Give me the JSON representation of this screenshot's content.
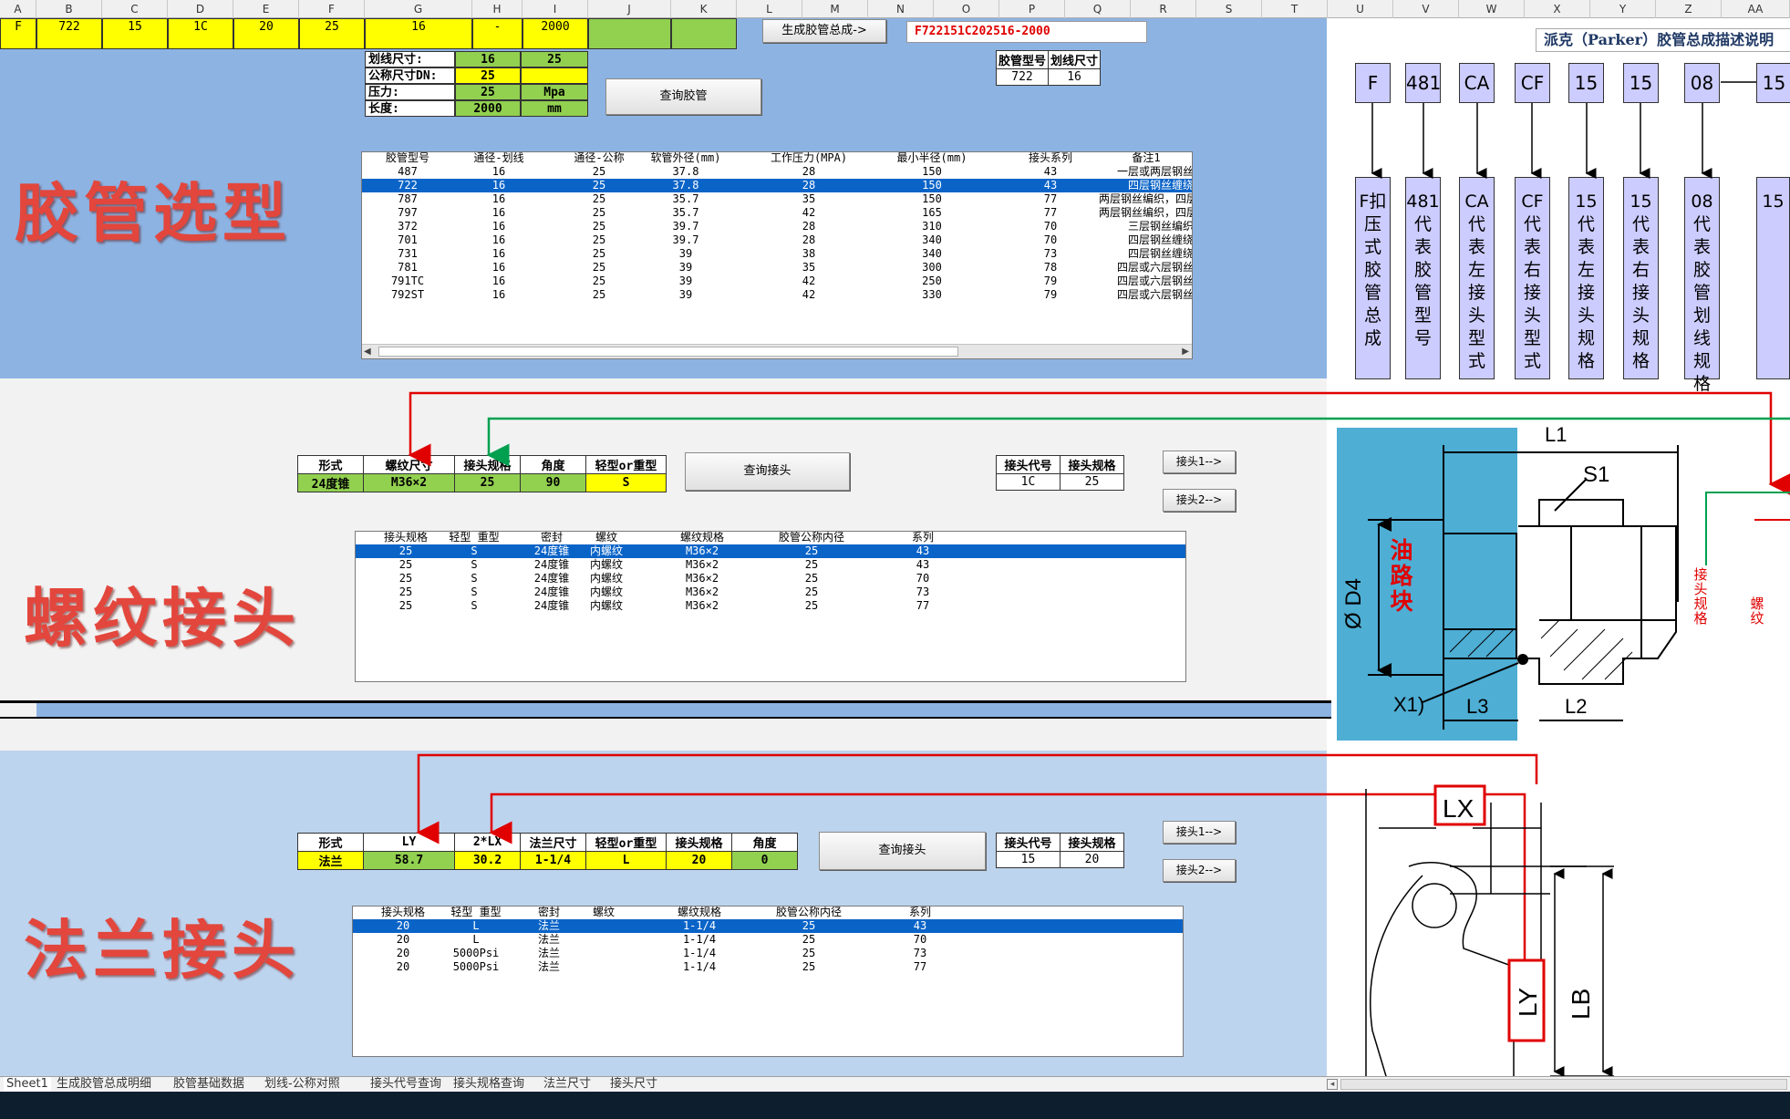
{
  "columns": [
    "A",
    "B",
    "C",
    "D",
    "E",
    "F",
    "G",
    "H",
    "I",
    "J",
    "K",
    "L",
    "M",
    "N",
    "O",
    "P",
    "Q",
    "R",
    "S",
    "T",
    "U",
    "V",
    "W",
    "X",
    "Y",
    "Z",
    "AA"
  ],
  "row1": [
    "F",
    "722",
    "15",
    "1C",
    "20",
    "25",
    "16",
    "-",
    "2000"
  ],
  "buttons": {
    "generate": "生成胶管总成->",
    "query_hose": "查询胶管",
    "query_fitting": "查询接头",
    "query_fitting2": "查询接头",
    "fitting1": "接头1-->",
    "fitting2": "接头2-->",
    "fitting1_b": "接头1-->",
    "fitting2_b": "接头2-->"
  },
  "part_code": "F722151C202516-2000",
  "hose_params": [
    {
      "label": "划线尺寸:",
      "value": "16",
      "extra": "25"
    },
    {
      "label": "公称尺寸DN:",
      "value": "25",
      "extra": ""
    },
    {
      "label": "压力:",
      "value": "25",
      "extra": "Mpa"
    },
    {
      "label": "长度:",
      "value": "2000",
      "extra": "mm"
    }
  ],
  "hose_info": {
    "headers": [
      "胶管型号",
      "划线尺寸"
    ],
    "values": [
      "722",
      "16"
    ]
  },
  "titles": {
    "hose": "胶管选型",
    "thread": "螺纹接头",
    "flange": "法兰接头"
  },
  "hose_list": {
    "headers": [
      "胶管型号",
      "通径-划线",
      "通径-公称",
      "软管外径(mm)",
      "工作压力(MPA)",
      "最小半径(mm)",
      "接头系列",
      "备注1"
    ],
    "rows": [
      [
        "487",
        "16",
        "25",
        "37.8",
        "28",
        "150",
        "43",
        "一层或两层钢丝"
      ],
      [
        "722",
        "16",
        "25",
        "37.8",
        "28",
        "150",
        "43",
        "四层钢丝缠绕"
      ],
      [
        "787",
        "16",
        "25",
        "35.7",
        "35",
        "150",
        "77",
        "两层钢丝编织，四层"
      ],
      [
        "797",
        "16",
        "25",
        "35.7",
        "42",
        "165",
        "77",
        "两层钢丝编织，四层"
      ],
      [
        "372",
        "16",
        "25",
        "39.7",
        "28",
        "310",
        "70",
        "三层钢丝编织"
      ],
      [
        "701",
        "16",
        "25",
        "39.7",
        "28",
        "340",
        "70",
        "四层钢丝缠绕"
      ],
      [
        "731",
        "16",
        "25",
        "39",
        "38",
        "340",
        "73",
        "四层钢丝缠绕"
      ],
      [
        "781",
        "16",
        "25",
        "39",
        "35",
        "300",
        "78",
        "四层或六层钢丝"
      ],
      [
        "791TC",
        "16",
        "25",
        "39",
        "42",
        "250",
        "79",
        "四层或六层钢丝"
      ],
      [
        "792ST",
        "16",
        "25",
        "39",
        "42",
        "330",
        "79",
        "四层或六层钢丝"
      ]
    ],
    "selected": 1
  },
  "thread_sel": {
    "headers": [
      "形式",
      "螺纹尺寸",
      "接头规格",
      "角度",
      "轻型or重型"
    ],
    "values": [
      "24度锥",
      "M36×2",
      "25",
      "90",
      "S"
    ]
  },
  "thread_code": {
    "headers": [
      "接头代号",
      "接头规格"
    ],
    "values": [
      "1C",
      "25"
    ]
  },
  "thread_list": {
    "headers": [
      "接头规格",
      "轻型 重型",
      "密封",
      "螺纹",
      "螺纹规格",
      "胶管公称内径",
      "系列"
    ],
    "rows": [
      [
        "25",
        "S",
        "24度锥",
        "内螺纹",
        "M36×2",
        "25",
        "43"
      ],
      [
        "25",
        "S",
        "24度锥",
        "内螺纹",
        "M36×2",
        "25",
        "43"
      ],
      [
        "25",
        "S",
        "24度锥",
        "内螺纹",
        "M36×2",
        "25",
        "70"
      ],
      [
        "25",
        "S",
        "24度锥",
        "内螺纹",
        "M36×2",
        "25",
        "73"
      ],
      [
        "25",
        "S",
        "24度锥",
        "内螺纹",
        "M36×2",
        "25",
        "77"
      ]
    ],
    "selected": 0
  },
  "flange_sel": {
    "headers": [
      "形式",
      "LY",
      "2*LX",
      "法兰尺寸",
      "轻型or重型",
      "接头规格",
      "角度"
    ],
    "values": [
      "法兰",
      "58.7",
      "30.2",
      "1-1/4",
      "L",
      "20",
      "0"
    ]
  },
  "flange_code": {
    "headers": [
      "接头代号",
      "接头规格"
    ],
    "values": [
      "15",
      "20"
    ]
  },
  "flange_list": {
    "headers": [
      "接头规格",
      "轻型 重型",
      "密封",
      "螺纹",
      "螺纹规格",
      "胶管公称内径",
      "系列"
    ],
    "rows": [
      [
        "20",
        "L",
        "法兰",
        "",
        "1-1/4",
        "25",
        "43"
      ],
      [
        "20",
        "L",
        "法兰",
        "",
        "1-1/4",
        "25",
        "70"
      ],
      [
        "20",
        "5000Psi",
        "法兰",
        "",
        "1-1/4",
        "25",
        "73"
      ],
      [
        "20",
        "5000Psi",
        "法兰",
        "",
        "1-1/4",
        "25",
        "77"
      ]
    ],
    "selected": 0
  },
  "parker": {
    "title": "派克（Parker）胶管总成描述说明",
    "codes": [
      "F",
      "481",
      "CA",
      "CF",
      "15",
      "15",
      "08",
      "15"
    ],
    "descriptions": [
      "F扣压式胶管总成",
      "481代表胶管型号",
      "CA代表左接头型式",
      "CF代表右接头型式",
      "15代表左接头规格",
      "15代表右接头规格",
      "08代表胶管划线规格",
      "15"
    ]
  },
  "drawing1": {
    "L1": "L1",
    "S1": "S1",
    "D4": "Ø D4",
    "block": "油路块",
    "X1": "X1)",
    "L3": "L3",
    "L2": "L2",
    "spec": "接头规格",
    "thread": "螺纹"
  },
  "drawing2": {
    "LX": "LX",
    "LY": "LY",
    "LB": "LB"
  },
  "tabs": [
    "Sheet1",
    "生成胶管总成明细",
    "胶管基础数据",
    "划线-公称对照",
    "接头代号查询",
    "接头规格查询",
    "法兰尺寸",
    "接头尺寸"
  ]
}
